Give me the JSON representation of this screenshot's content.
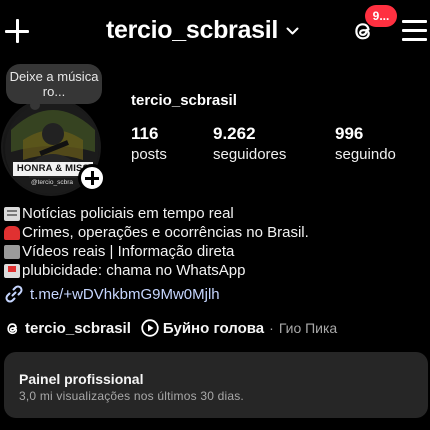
{
  "header": {
    "username": "tercio_scbrasil",
    "notification_count": "9...",
    "icons": [
      "plus-icon",
      "chevron-down-icon",
      "threads-icon",
      "menu-icon"
    ]
  },
  "note": {
    "text": "Deixe a música ro..."
  },
  "avatar": {
    "banner_text": "HONRA & MISS",
    "handle_text": "@tercio_scbra"
  },
  "profile": {
    "display_name": "tercio_scbrasil",
    "stats": [
      {
        "value": "116",
        "label": "posts"
      },
      {
        "value": "9.262",
        "label": "seguidores"
      },
      {
        "value": "996",
        "label": "seguindo"
      }
    ]
  },
  "bio": {
    "lines": [
      {
        "icon": "newspaper-emoji",
        "text": "Notícias policiais em tempo real"
      },
      {
        "icon": "police-light-emoji",
        "text": "Crimes, operações e ocorrências no Brasil."
      },
      {
        "icon": "movie-camera-emoji",
        "text": "Vídeos reais | Informação direta"
      },
      {
        "icon": "inbox-tray-emoji",
        "text": "plubicidade: chama no WhatsApp"
      }
    ],
    "link": "t.me/+wDVhkbmG9Mw0Mjlh"
  },
  "threads_row": {
    "threads_name": "tercio_scbrasil",
    "song_title": "Буйно голова",
    "separator": "·",
    "artist": "Гио Пика"
  },
  "professional_panel": {
    "title": "Painel profissional",
    "subtitle": "3,0 mi visualizações nos últimos 30 dias."
  },
  "colors": {
    "background": "#000000",
    "badge": "#ff3040",
    "link": "#c6d6ff",
    "panel": "#262626",
    "muted_text": "#a8a8a8"
  }
}
